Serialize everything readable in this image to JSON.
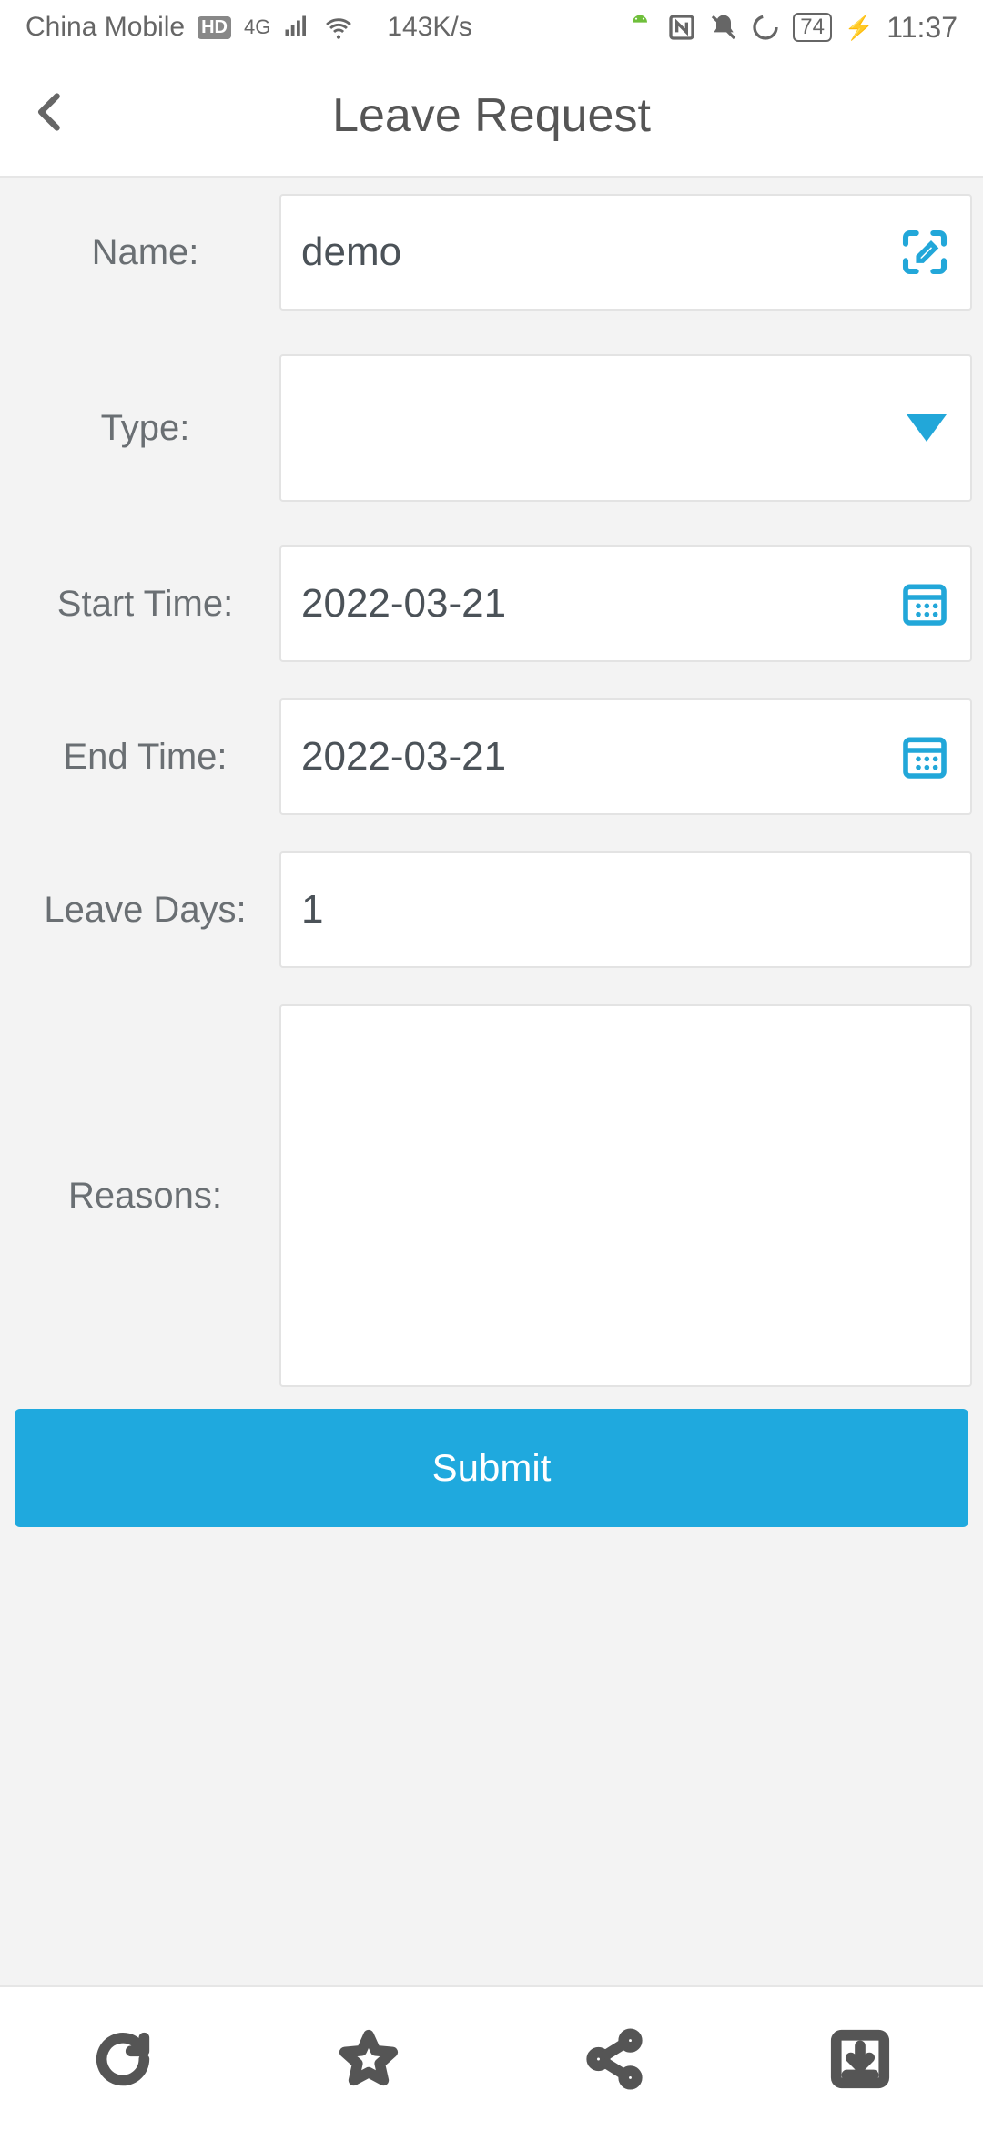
{
  "status": {
    "carrier": "China Mobile",
    "net_speed": "143K/s",
    "battery": "74",
    "time": "11:37",
    "signal_type": "4G"
  },
  "header": {
    "title": "Leave Request"
  },
  "form": {
    "name_label": "Name:",
    "name_value": "demo",
    "type_label": "Type:",
    "type_value": "",
    "start_label": "Start Time:",
    "start_value": "2022-03-21",
    "end_label": "End Time:",
    "end_value": "2022-03-21",
    "days_label": "Leave Days:",
    "days_value": "1",
    "reasons_label": "Reasons:",
    "reasons_value": ""
  },
  "actions": {
    "submit": "Submit"
  }
}
